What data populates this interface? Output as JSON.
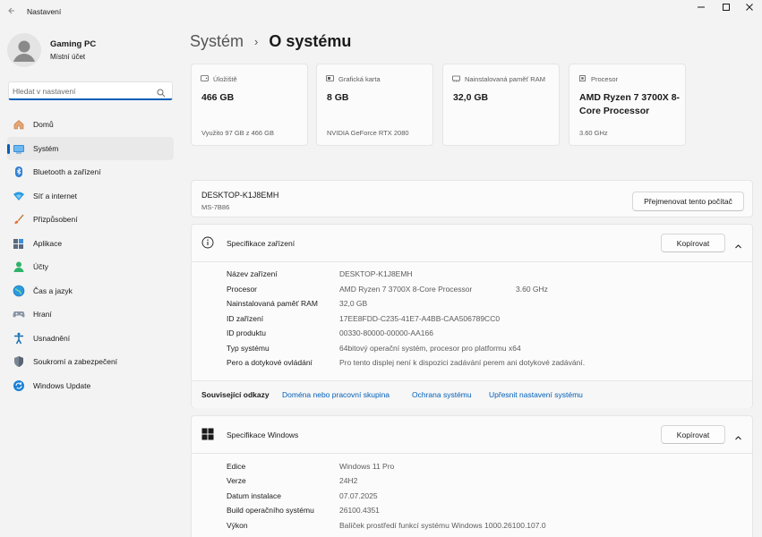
{
  "window": {
    "title": "Nastavení"
  },
  "profile": {
    "name": "Gaming PC",
    "account": "Místní účet"
  },
  "search": {
    "placeholder": "Hledat v nastavení"
  },
  "sidebar": {
    "items": [
      {
        "label": "Domů",
        "icon": "home-icon",
        "active": false
      },
      {
        "label": "Systém",
        "icon": "system-icon",
        "active": true
      },
      {
        "label": "Bluetooth a zařízení",
        "icon": "bluetooth-icon",
        "active": false
      },
      {
        "label": "Síť a internet",
        "icon": "network-icon",
        "active": false
      },
      {
        "label": "Přizpůsobení",
        "icon": "brush-icon",
        "active": false
      },
      {
        "label": "Aplikace",
        "icon": "apps-icon",
        "active": false
      },
      {
        "label": "Účty",
        "icon": "accounts-icon",
        "active": false
      },
      {
        "label": "Čas a jazyk",
        "icon": "time-language-icon",
        "active": false
      },
      {
        "label": "Hraní",
        "icon": "gaming-icon",
        "active": false
      },
      {
        "label": "Usnadnění",
        "icon": "accessibility-icon",
        "active": false
      },
      {
        "label": "Soukromí a zabezpečení",
        "icon": "shield-icon",
        "active": false
      },
      {
        "label": "Windows Update",
        "icon": "update-icon",
        "active": false
      }
    ]
  },
  "breadcrumb": {
    "parent": "Systém",
    "separator": "›",
    "current": "O systému"
  },
  "hardware_cards": [
    {
      "title": "Úložiště",
      "icon": "storage-icon",
      "value": "466 GB",
      "sub": "Využito 97 GB z 466 GB"
    },
    {
      "title": "Grafická karta",
      "icon": "gpu-icon",
      "value": "8 GB",
      "sub": "NVIDIA GeForce RTX 2080"
    },
    {
      "title": "Nainstalovaná paměť RAM",
      "icon": "ram-icon",
      "value": "32,0 GB",
      "sub": ""
    },
    {
      "title": "Procesor",
      "icon": "cpu-icon",
      "value": "AMD Ryzen 7 3700X 8-Core Processor",
      "sub": "3.60 GHz"
    }
  ],
  "device": {
    "name": "DESKTOP-K1J8EMH",
    "model": "MS-7B86",
    "rename_label": "Přejmenovat tento počítač"
  },
  "device_specs": {
    "title": "Specifikace zařízení",
    "copy_label": "Kopírovat",
    "rows": [
      {
        "label": "Název zařízení",
        "value": "DESKTOP-K1J8EMH",
        "extra": ""
      },
      {
        "label": "Procesor",
        "value": "AMD Ryzen 7 3700X 8-Core Processor",
        "extra": "3.60 GHz"
      },
      {
        "label": "Nainstalovaná paměť RAM",
        "value": "32,0 GB",
        "extra": ""
      },
      {
        "label": "ID zařízení",
        "value": "17EE8FDD-C235-41E7-A4BB-CAA506789CC0",
        "extra": ""
      },
      {
        "label": "ID produktu",
        "value": "00330-80000-00000-AA166",
        "extra": ""
      },
      {
        "label": "Typ systému",
        "value": "64bitový operační systém, procesor pro platformu x64",
        "extra": ""
      },
      {
        "label": "Pero a dotykové ovládání",
        "value": "Pro tento displej není k dispozici zadávání perem ani dotykové zadávání.",
        "extra": ""
      }
    ],
    "related_title": "Související odkazy",
    "related_links": [
      "Doména nebo pracovní skupina",
      "Ochrana systému",
      "Upřesnit nastavení systému"
    ]
  },
  "windows_specs": {
    "title": "Specifikace Windows",
    "copy_label": "Kopírovat",
    "rows": [
      {
        "label": "Edice",
        "value": "Windows 11 Pro"
      },
      {
        "label": "Verze",
        "value": "24H2"
      },
      {
        "label": "Datum instalace",
        "value": "07.07.2025"
      },
      {
        "label": "Build operačního systému",
        "value": "26100.4351"
      },
      {
        "label": "Výkon",
        "value": "Balíček prostředí funkcí systému Windows 1000.26100.107.0"
      }
    ]
  },
  "colors": {
    "accent": "#005fb8",
    "background": "#f3f3f3",
    "card": "#fbfbfb"
  }
}
